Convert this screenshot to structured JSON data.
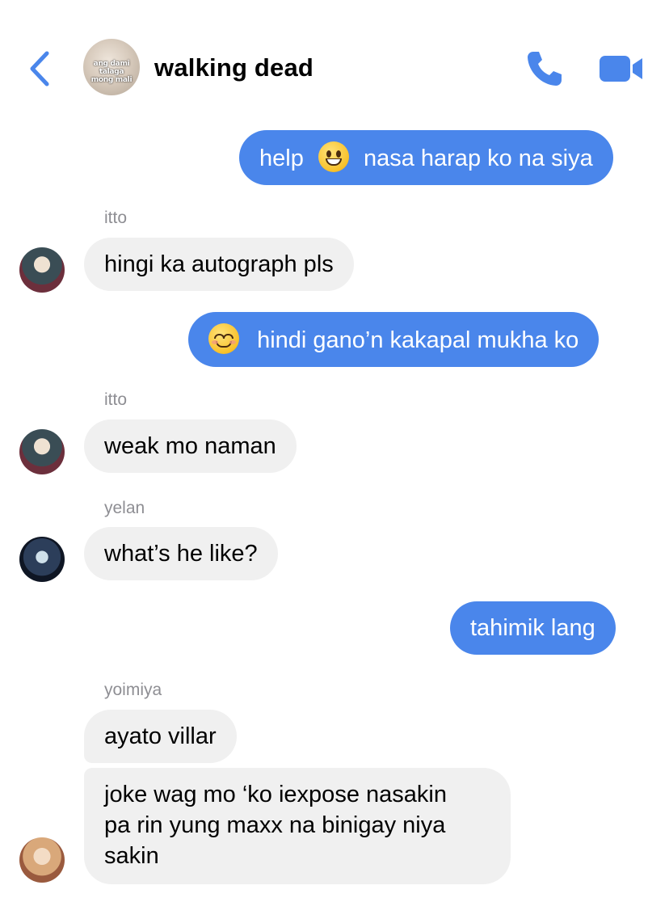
{
  "header": {
    "title": "walking dead",
    "group_avatar_caption": "ang dami talaga mong mali",
    "icons": {
      "back": "chevron-left-icon",
      "call": "phone-icon",
      "video": "video-camera-icon"
    }
  },
  "colors": {
    "accent": "#4a86eb",
    "incoming_bubble": "#f0f0f0",
    "sender_name": "#8e8e93"
  },
  "messages": [
    {
      "direction": "out",
      "parts": [
        "help",
        "nasa harap ko na siya"
      ],
      "emoji": "grinning-face"
    },
    {
      "direction": "in",
      "sender": "itto",
      "text": "hingi ka autograph pls"
    },
    {
      "direction": "out",
      "emoji": "smiling-face-with-smiling-eyes",
      "text": "hindi gano’n kakapal mukha ko"
    },
    {
      "direction": "in",
      "sender": "itto",
      "text": "weak mo naman"
    },
    {
      "direction": "in",
      "sender": "yelan",
      "text": "what’s he like?"
    },
    {
      "direction": "out",
      "text": "tahimik lang"
    },
    {
      "direction": "in",
      "sender": "yoimiya",
      "text": "ayato villar"
    },
    {
      "direction": "in",
      "sender": "yoimiya",
      "lines": [
        "joke wag mo ‘ko iexpose nasakin",
        "pa rin yung maxx na binigay niya",
        "sakin"
      ]
    }
  ]
}
